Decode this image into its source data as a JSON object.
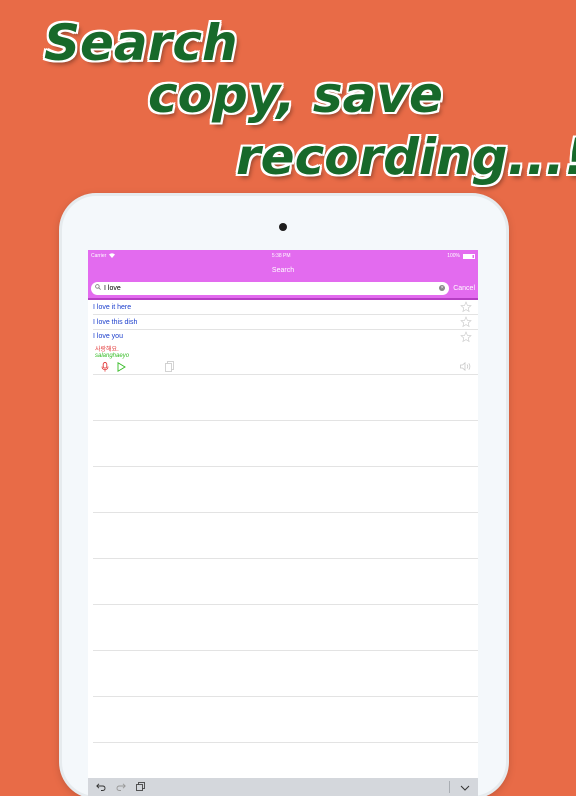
{
  "headline": {
    "line1": "Search",
    "line2": "copy, save",
    "line3": "recording...!"
  },
  "status_bar": {
    "carrier": "Carrier",
    "time": "5:38 PM",
    "battery": "100%"
  },
  "nav": {
    "title": "Search"
  },
  "search": {
    "value": "I love",
    "cancel_label": "Cancel"
  },
  "results": [
    {
      "phrase": "I love it here",
      "favorited": false
    },
    {
      "phrase": "I love this dish",
      "favorited": false
    },
    {
      "phrase": "I love you",
      "korean": "사랑해요.",
      "romanization": "salanghaeyo",
      "favorited": false
    }
  ],
  "colors": {
    "background": "#E86B47",
    "headline": "#17692A",
    "nav_bar": "#E36BEF",
    "phrase": "#1A3DCC",
    "korean": "#E23A3A",
    "romanization": "#33BB22"
  },
  "icons": {
    "search": "search-icon",
    "clear": "clear-icon",
    "star": "star-outline-icon",
    "record": "microphone-icon",
    "play": "play-icon",
    "copy": "copy-icon",
    "speaker": "speaker-icon",
    "undo": "undo-icon",
    "redo": "redo-icon",
    "paste": "paste-icon",
    "dismiss_keyboard": "chevron-down-icon"
  }
}
